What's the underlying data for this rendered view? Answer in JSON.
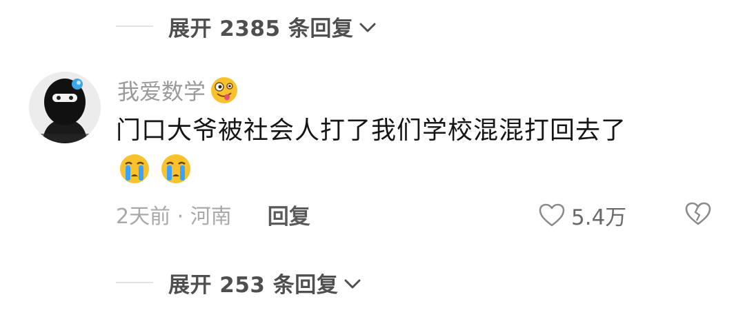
{
  "expand_top": {
    "label": "展开 2385 条回复"
  },
  "comment": {
    "username": "我爱数学",
    "username_emoji": "goofy-face-emoji",
    "text": "门口大爷被社会人打了我们学校混混打回去了",
    "trailing_emojis": [
      "crying-face-emoji",
      "crying-face-emoji"
    ],
    "time_location": "2天前 · 河南",
    "reply_label": "回复",
    "like_count": "5.4万",
    "icons": {
      "like": "heart-outline-icon",
      "dislike": "broken-heart-icon",
      "avatar": "avatar-ninja-mask"
    }
  },
  "expand_bottom": {
    "label": "展开 253 条回复"
  },
  "colors": {
    "text_primary": "#161616",
    "text_muted": "#9a9a9a",
    "divider": "#e3e3e3",
    "emoji_yellow": "#f7c22c",
    "emoji_tear": "#3aa3ff"
  }
}
